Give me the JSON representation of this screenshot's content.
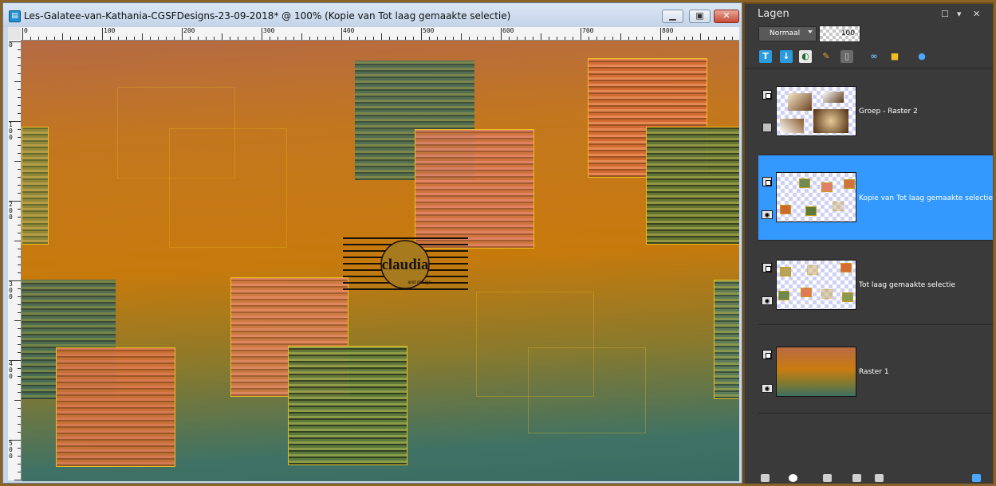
{
  "window": {
    "title": "Les-Galatee-van-Kathania-CGSFDesigns-23-09-2018* @ 100% (Kopie van Tot laag gemaakte selectie)",
    "app_icon": "document-icon",
    "buttons": {
      "minimize": "minimize-icon",
      "restore": "restore-icon",
      "close": "close-icon"
    }
  },
  "ruler": {
    "h_labels": [
      "0",
      "100",
      "200",
      "300",
      "400",
      "500",
      "600",
      "700",
      "800"
    ],
    "v_labels": [
      "0",
      "1\n0\n0",
      "2\n0\n0",
      "3\n0\n0",
      "4\n0\n0",
      "5\n0\n0"
    ]
  },
  "canvas": {
    "watermark_text": "claudia",
    "watermark_sub": "and design"
  },
  "layers_panel": {
    "title": "Lagen",
    "blend_mode": "Normaal",
    "opacity": "100",
    "toolbar_icons": [
      "new-raster-layer-icon",
      "new-vector-layer-icon",
      "new-adjustment-layer-icon",
      "new-mask-icon",
      "delete-layer-icon",
      "link-icon",
      "lock-icon",
      "layer-styles-icon"
    ],
    "layers": [
      {
        "name": "Groep - Raster 2",
        "selected": false,
        "visible": false
      },
      {
        "name": "Kopie van Tot laag gemaakte selectie",
        "selected": true,
        "visible": true
      },
      {
        "name": "Tot laag gemaakte selectie",
        "selected": false,
        "visible": true
      },
      {
        "name": "Raster 1",
        "selected": false,
        "visible": true
      }
    ]
  },
  "colors": {
    "accent": "#3399ff",
    "panel_bg": "#3a3a3a",
    "tile_border": "#f3c520"
  }
}
